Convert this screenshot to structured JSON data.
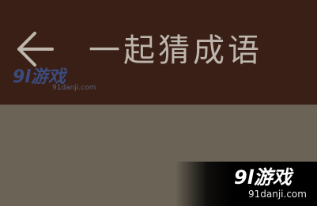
{
  "header": {
    "back_icon": "arrow-left-icon",
    "title": "一起猜成语"
  },
  "watermark_top": {
    "brand": "9l游戏",
    "url": "91danji.com"
  },
  "watermark_corner": {
    "brand": "9l游戏",
    "url": "91danji.com"
  },
  "colors": {
    "header_bg": "#3a1f16",
    "content_bg": "#6a6356",
    "title_text": "#bdb6ad"
  }
}
